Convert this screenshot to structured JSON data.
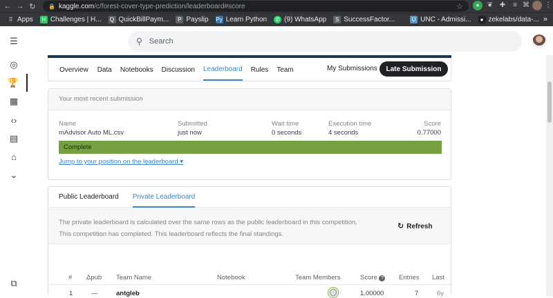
{
  "browser": {
    "url_host": "kaggle.com",
    "url_path": "/c/forest-cover-type-prediction/leaderboard#score",
    "bookmarks": [
      {
        "label": "Apps",
        "icon": "apps-grid-icon",
        "color": "#e8eaed"
      },
      {
        "label": "Challenges | H...",
        "icon": "hackerrank-icon",
        "color": "#2ec866"
      },
      {
        "label": "QuickBillPaym...",
        "icon": "quickbill-icon",
        "color": "#e8eaed"
      },
      {
        "label": "Payslip",
        "icon": "payslip-icon",
        "color": "#e8eaed"
      },
      {
        "label": "Learn Python",
        "icon": "python-icon",
        "color": "#3776ab"
      },
      {
        "label": "(9) WhatsApp",
        "icon": "whatsapp-icon",
        "color": "#25d366"
      },
      {
        "label": "SuccessFactor...",
        "icon": "successfactors-icon",
        "color": "#e8eaed"
      },
      {
        "label": "UNC - Admissi...",
        "icon": "unc-icon",
        "color": "#4b9cd3"
      },
      {
        "label": "zekelabs/data-...",
        "icon": "github-icon",
        "color": "#e8eaed"
      }
    ]
  },
  "search": {
    "placeholder": "Search"
  },
  "competition_tabs": {
    "items": [
      "Overview",
      "Data",
      "Notebooks",
      "Discussion",
      "Leaderboard",
      "Rules",
      "Team"
    ],
    "active": "Leaderboard",
    "my_submissions": "My Submissions",
    "late_submission": "Late Submission"
  },
  "submission": {
    "header": "Your most recent submission",
    "name_label": "Name",
    "name": "mAdvisor Auto ML.csv",
    "submitted_label": "Submitted",
    "submitted": "just now",
    "wait_label": "Wait time",
    "wait": "0 seconds",
    "exec_label": "Execution time",
    "exec": "4 seconds",
    "score_label": "Score",
    "score": "0.77000",
    "status": "Complete",
    "status_color": "#76a142",
    "jump_link": "Jump to your position on the leaderboard"
  },
  "leaderboard": {
    "tabs": [
      "Public Leaderboard",
      "Private Leaderboard"
    ],
    "active_tab": "Private Leaderboard",
    "notice_line1": "The private leaderboard is calculated over the same rows as the public leaderboard in this competition.",
    "notice_line2": "This competition has completed. This leaderboard reflects the final standings.",
    "refresh": "Refresh",
    "columns": {
      "rank": "#",
      "delta": "Δpub",
      "team": "Team Name",
      "notebook": "Notebook",
      "members": "Team Members",
      "score": "Score",
      "entries": "Entries",
      "last": "Last"
    },
    "rows": [
      {
        "rank": "1",
        "delta": "—",
        "team": "antgleb",
        "score": "1.00000",
        "entries": "7",
        "last": "6y"
      }
    ]
  },
  "colors": {
    "accent": "#3c84c7",
    "dark": "#202124"
  }
}
